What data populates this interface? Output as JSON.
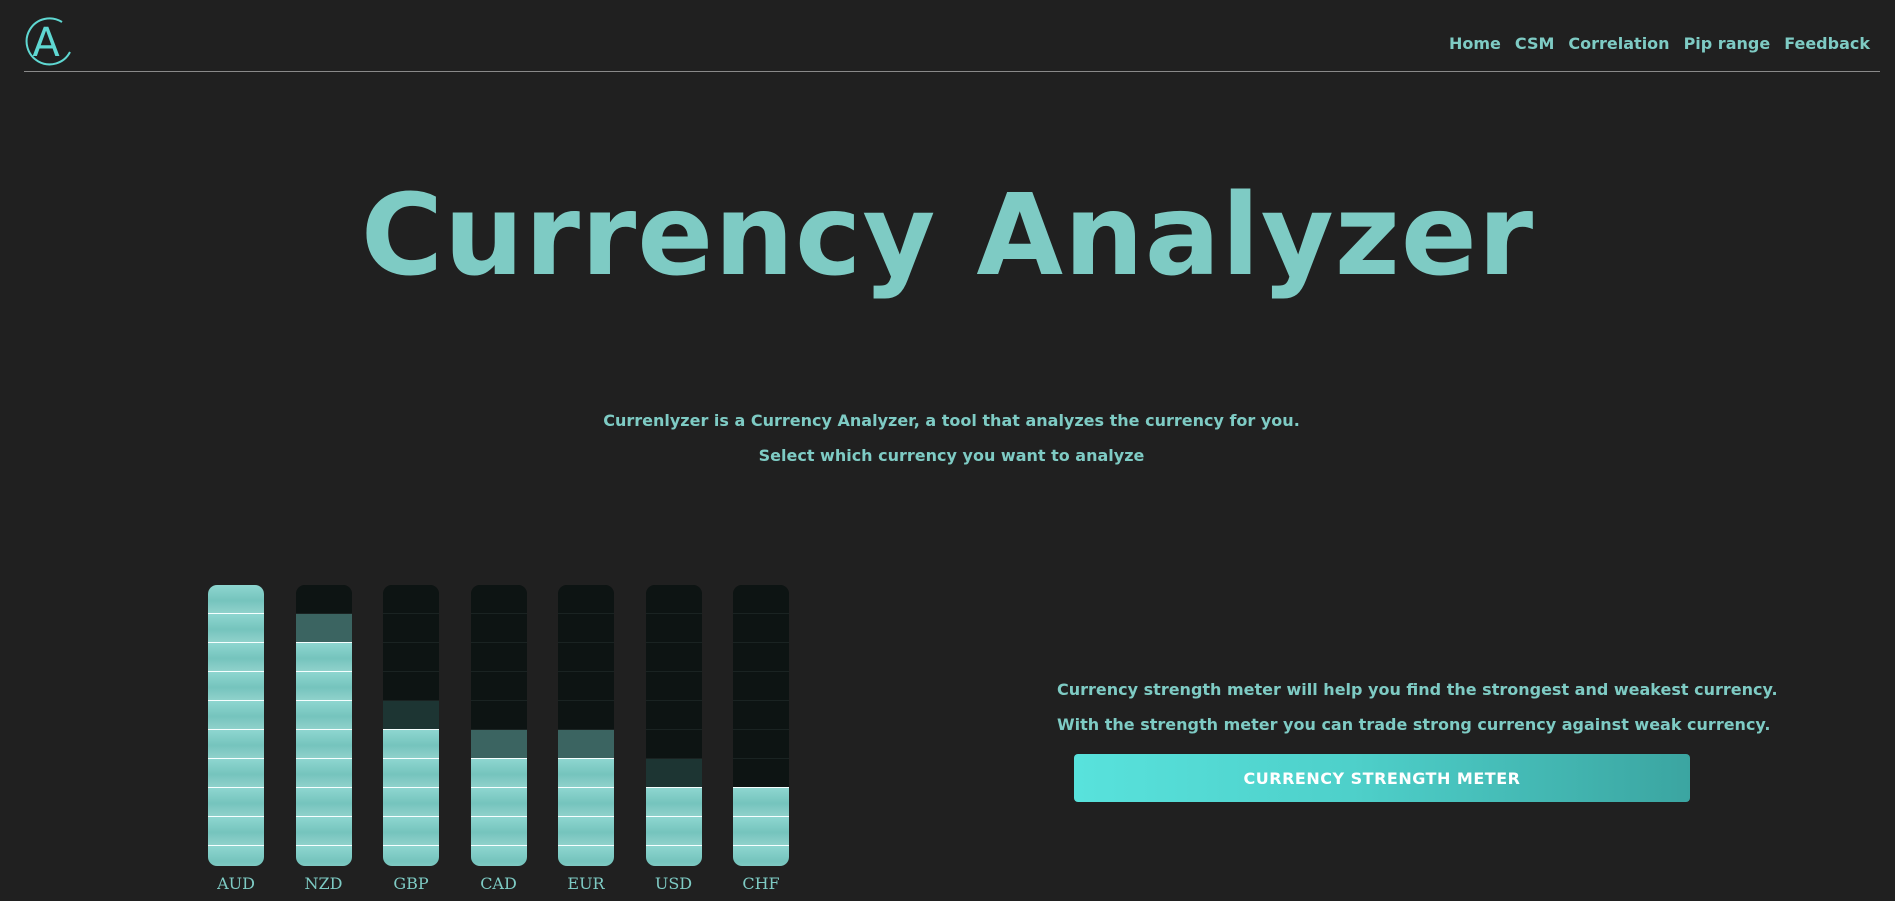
{
  "colors": {
    "accent": "#7ecbc4",
    "background": "#202020",
    "button_start": "#58e2dc",
    "button_end": "#3ba5a1"
  },
  "header": {
    "logo_letter": "A",
    "nav": [
      "Home",
      "CSM",
      "Correlation",
      "Pip range",
      "Feedback"
    ]
  },
  "hero": {
    "title": "Currency Analyzer",
    "description": "Currenlyzer is a Currency Analyzer, a tool that analyzes the currency for you.",
    "prompt": "Select which currency you want to analyze"
  },
  "strength_meter": {
    "max_level": 10,
    "currencies": [
      {
        "name": "AUD",
        "level": 10,
        "dim_levels": 0
      },
      {
        "name": "NZD",
        "level": 8,
        "dim_levels": 1
      },
      {
        "name": "GBP",
        "level": 5,
        "dim_levels": 1
      },
      {
        "name": "CAD",
        "level": 4,
        "dim_levels": 1
      },
      {
        "name": "EUR",
        "level": 4,
        "dim_levels": 1
      },
      {
        "name": "USD",
        "level": 3,
        "dim_levels": 1
      },
      {
        "name": "CHF",
        "level": 3,
        "dim_levels": 0
      }
    ]
  },
  "csm": {
    "line1": "Currency strength meter will help you find the strongest and weakest currency.",
    "line2": "With the strength meter you can trade strong currency against weak currency.",
    "button_label": "CURRENCY STRENGTH METER"
  }
}
